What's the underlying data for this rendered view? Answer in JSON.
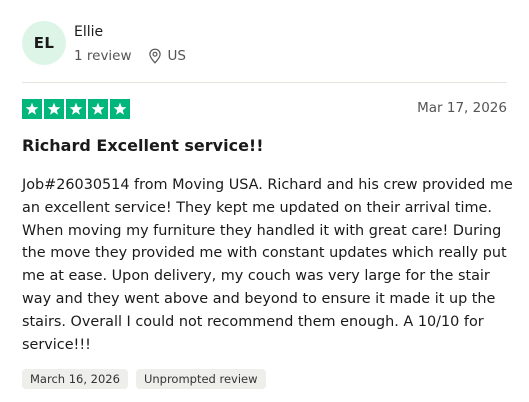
{
  "reviewer": {
    "initials": "EL",
    "name": "Ellie",
    "review_count": "1 review",
    "country": "US",
    "avatar_color": "#dcf5e6"
  },
  "review": {
    "rating": 5,
    "star_color": "#00b67a",
    "date": "Mar 17, 2026",
    "title": "Richard Excellent service!!",
    "text": "Job#26030514 from Moving USA. Richard and his crew provided me an excellent service! They kept me updated on their arrival time. When moving my furniture they handled it with great care! During the move they provided me with constant updates which really put me at ease. Upon delivery, my couch was very large for the stair way and they went above and beyond to ensure it made it up the stairs. Overall I could not recommend them enough. A 10/10 for service!!!"
  },
  "tags": {
    "experience_date": "March 16, 2026",
    "review_type": "Unprompted review"
  },
  "icons": {
    "location": "location-pin-icon",
    "star": "star-icon"
  }
}
